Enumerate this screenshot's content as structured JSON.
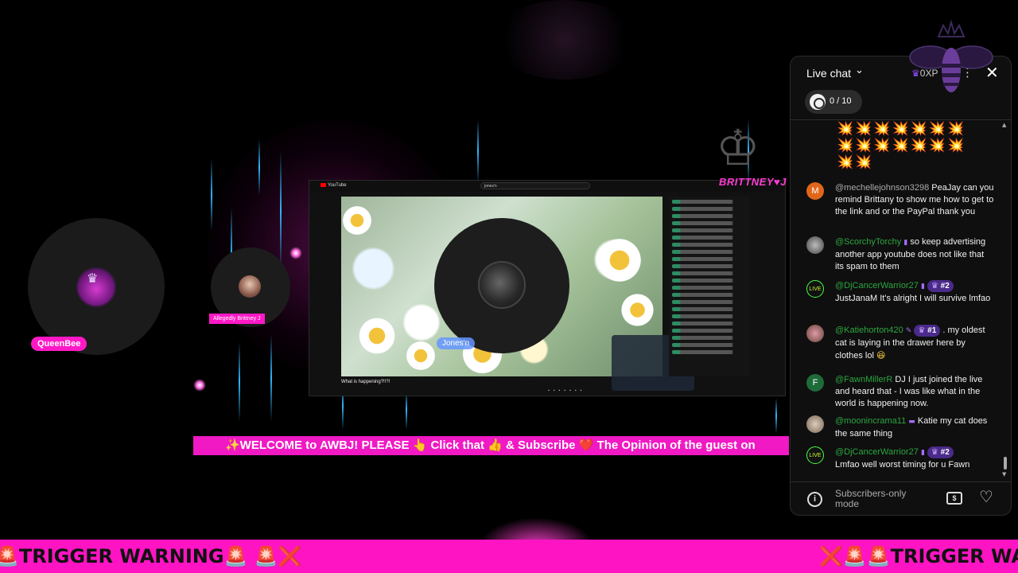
{
  "colors": {
    "accent_pink": "#ff14c4",
    "chat_bg": "#0f0f0f",
    "author_green": "#2ba640",
    "rank_purple": "#4a2a8a"
  },
  "stream": {
    "host_name": "QueenBee",
    "guest1_label": "Allegedly Brittney J",
    "guest2_name": "Jones'n",
    "brand_logo": "BRITTNEY♥J",
    "welcome_banner": "✨WELCOME to AWBJ! PLEASE 👆 Click that 👍 & Subscribe ❤️ The Opinion of the guest on",
    "trigger_warning_left": "🚨TRIGGER WARNING🚨 🚨❌",
    "trigger_warning_right": "❌🚨🚨TRIGGER WA"
  },
  "embedded_screen": {
    "app": "YouTube",
    "search_value": "jones'n",
    "video_title": "What is happening?!!?!"
  },
  "chat": {
    "title": "Live chat",
    "xp": "0XP",
    "goal": "0 / 10",
    "emoji_row": "💥💥💥💥💥💥💥💥💥💥💥💥💥💥💥💥",
    "footer_mode": "Subscribers-only mode",
    "messages": [
      {
        "initial": "M",
        "author": "@mechellejohnson3298",
        "text": "PeaJay can you remind Brittany to show me how to get to the link and or the PayPal thank you"
      },
      {
        "initial": "",
        "author": "@ScorchyTorchy",
        "text": "so keep advertising another app youtube does not like that its spam to them"
      },
      {
        "initial": "",
        "author": "@DjCancerWarrior27",
        "rank": "#2",
        "text": "JustJanaM It's alright I will survive lmfao"
      },
      {
        "initial": "",
        "author": "@Katiehorton420",
        "rank": "#1",
        "text": ". my oldest cat is laying in the drawer here by clothes lol",
        "emoji": "😆"
      },
      {
        "initial": "F",
        "author": "@FawnMillerR",
        "text": "DJ I just joined the live and heard that - I was like what in the world is happening now."
      },
      {
        "initial": "",
        "author": "@moonincrama11",
        "text": "Katie my cat does the same thing"
      },
      {
        "initial": "",
        "author": "@DjCancerWarrior27",
        "rank": "#2",
        "text": "Lmfao well worst timing for u Fawn"
      }
    ]
  }
}
